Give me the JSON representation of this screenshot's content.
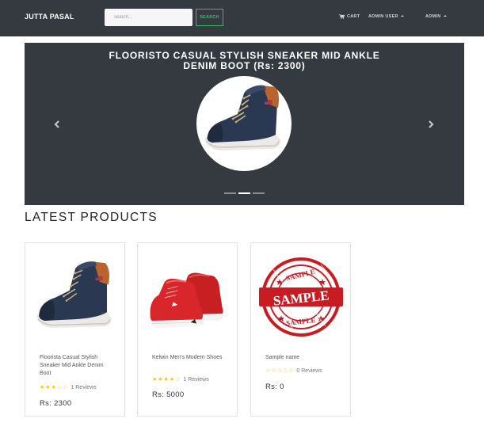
{
  "navbar": {
    "brand": "JUTTA PASAL",
    "search_placeholder": "search...",
    "search_button": "SEARCH",
    "cart_label": "CART",
    "admin_user_label": "ADMIN USER",
    "admin_label": "ADMIN",
    "cart_icon": "cart-icon",
    "caret_icon": "caret-down-icon"
  },
  "carousel": {
    "title": "FLOORISTO CASUAL STYLISH SNEAKER MID ANKLE DENIM BOOT (Rs: 2300)",
    "prev_icon": "chevron-left-icon",
    "next_icon": "chevron-right-icon",
    "slide_count": 3,
    "active_slide": 2
  },
  "section": {
    "title": "LATEST PRODUCTS"
  },
  "products": [
    {
      "name": "Floorista Casual Stylish Sneaker Mid Ankle Denim Boot",
      "rating": 3,
      "reviews": "1 Reviews",
      "price": "Rs: 2300",
      "image": "denim-sneaker-image"
    },
    {
      "name": "Kelwin Men's Modern Shoes",
      "rating": 4,
      "reviews": "1 Reviews",
      "price": "Rs: 5000",
      "image": "red-shoes-image"
    },
    {
      "name": "Sample name",
      "rating": 0,
      "reviews": "0 Reviews",
      "price": "Rs: 0",
      "image": "sample-stamp-image"
    }
  ],
  "colors": {
    "navbar_bg": "#343a40",
    "accent_green": "#3fb86a",
    "star_yellow": "#f8c20f"
  }
}
